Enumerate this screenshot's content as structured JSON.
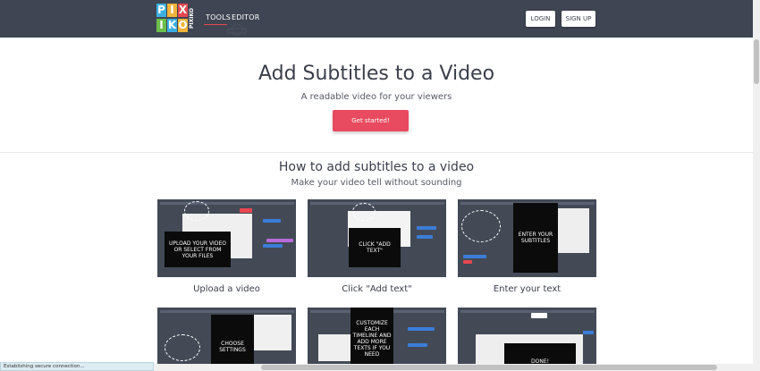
{
  "header": {
    "logo_letters": [
      "P",
      "I",
      "X",
      "I",
      "K",
      "O"
    ],
    "logo_side_text": "PIXIKO",
    "nav": [
      {
        "label": "TOOLS"
      },
      {
        "label": "EDITOR"
      }
    ],
    "login_label": "LOGIN",
    "signup_label": "SIGN UP",
    "colors": {
      "bar": "#3f4552",
      "accent": "#e6474f"
    }
  },
  "hero": {
    "title": "Add Subtitles to a Video",
    "subtitle": "A readable video for your viewers",
    "cta_label": "Get started!",
    "cta_color": "#e84a5f"
  },
  "howto": {
    "title": "How to add subtitles to a video",
    "subtitle": "Make your video tell without sounding",
    "steps": [
      {
        "overlay": "UPLOAD YOUR VIDEO OR SELECT FROM YOUR FILES",
        "caption": "Upload a video"
      },
      {
        "overlay": "CLICK \"ADD TEXT\"",
        "caption": "Click \"Add text\""
      },
      {
        "overlay": "ENTER YOUR SUBTITLES",
        "caption": "Enter your text"
      },
      {
        "overlay": "CHOOSE SETTINGS",
        "caption": ""
      },
      {
        "overlay": "CUSTOMIZE EACH TIMELINE AND ADD MORE TEXTS IF YOU NEED",
        "caption": ""
      },
      {
        "overlay": "DONE!",
        "caption": ""
      }
    ]
  },
  "status_bar": {
    "text": "Establishing secure connection..."
  }
}
